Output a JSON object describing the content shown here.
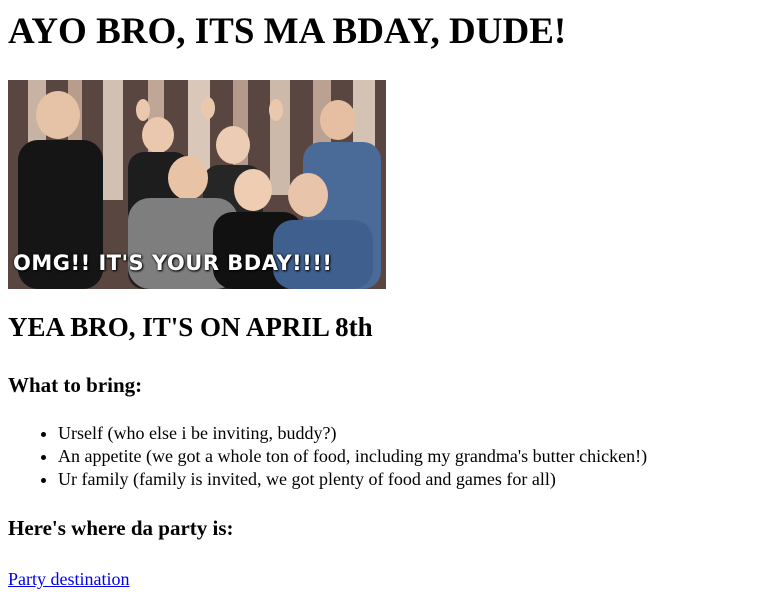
{
  "page": {
    "title": "AYO BRO, ITS MA BDAY, DUDE!",
    "gif_caption": "OMG!! IT'S YOUR BDAY!!!!",
    "date_heading": "YEA BRO, IT'S ON APRIL 8th",
    "bring_heading": "What to bring:",
    "bring_items": [
      "Urself (who else i be inviting, buddy?)",
      "An appetite (we got a whole ton of food, including my grandma's butter chicken!)",
      "Ur family (family is invited, we got plenty of food and games for all)"
    ],
    "location_heading": "Here's where da party is:",
    "location_link": "Party destination"
  },
  "colors": {
    "link": "#0000ee",
    "text": "#000000",
    "background": "#ffffff"
  }
}
